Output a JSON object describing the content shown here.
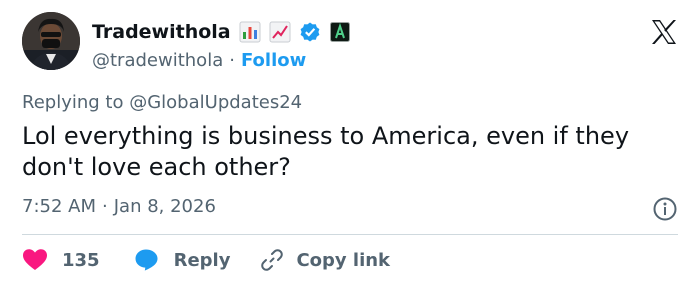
{
  "author": {
    "display_name": "Tradewithola",
    "handle": "@tradewithola",
    "separator": "·",
    "follow_label": "Follow",
    "badges": [
      "bar-chart-emoji",
      "trend-up-emoji",
      "verified-badge",
      "affiliate-badge"
    ],
    "verified_color": "#1d9bf0"
  },
  "reply_context": {
    "prefix": "Replying to",
    "handle": "@GlobalUpdates24"
  },
  "tweet": {
    "text": "Lol everything is business to America,  even if they don't love each other?",
    "time": "7:52 AM",
    "separator": "·",
    "date": "Jan 8, 2026"
  },
  "actions": {
    "like_count": "135",
    "reply_label": "Reply",
    "copy_label": "Copy link"
  },
  "colors": {
    "text": "#0f1419",
    "secondary": "#536471",
    "accent": "#1d9bf0",
    "like": "#f91880",
    "divider": "#cfd9de"
  },
  "icons": [
    "x-logo-icon",
    "info-icon",
    "heart-icon",
    "reply-bubble-icon",
    "link-icon"
  ]
}
